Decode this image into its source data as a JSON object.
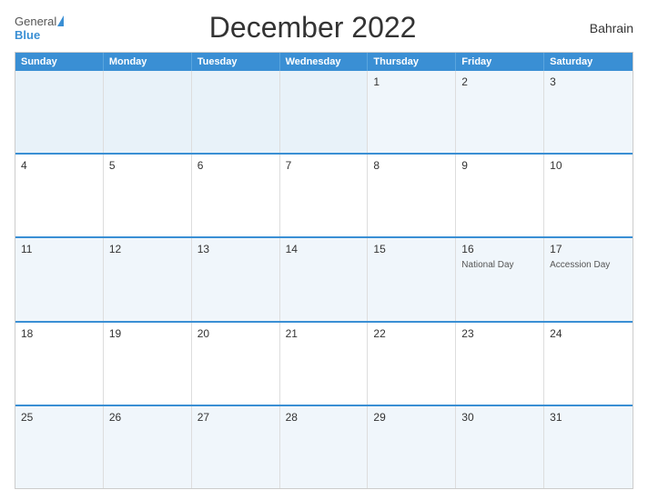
{
  "header": {
    "logo_general": "General",
    "logo_blue": "Blue",
    "title": "December 2022",
    "country": "Bahrain"
  },
  "calendar": {
    "weekdays": [
      "Sunday",
      "Monday",
      "Tuesday",
      "Wednesday",
      "Thursday",
      "Friday",
      "Saturday"
    ],
    "rows": [
      [
        {
          "day": "",
          "empty": true
        },
        {
          "day": "",
          "empty": true
        },
        {
          "day": "",
          "empty": true
        },
        {
          "day": "",
          "empty": true
        },
        {
          "day": "1",
          "empty": false
        },
        {
          "day": "2",
          "empty": false
        },
        {
          "day": "3",
          "empty": false
        }
      ],
      [
        {
          "day": "4",
          "empty": false
        },
        {
          "day": "5",
          "empty": false
        },
        {
          "day": "6",
          "empty": false
        },
        {
          "day": "7",
          "empty": false
        },
        {
          "day": "8",
          "empty": false
        },
        {
          "day": "9",
          "empty": false
        },
        {
          "day": "10",
          "empty": false
        }
      ],
      [
        {
          "day": "11",
          "empty": false
        },
        {
          "day": "12",
          "empty": false
        },
        {
          "day": "13",
          "empty": false
        },
        {
          "day": "14",
          "empty": false
        },
        {
          "day": "15",
          "empty": false
        },
        {
          "day": "16",
          "empty": false,
          "event": "National Day"
        },
        {
          "day": "17",
          "empty": false,
          "event": "Accession Day"
        }
      ],
      [
        {
          "day": "18",
          "empty": false
        },
        {
          "day": "19",
          "empty": false
        },
        {
          "day": "20",
          "empty": false
        },
        {
          "day": "21",
          "empty": false
        },
        {
          "day": "22",
          "empty": false
        },
        {
          "day": "23",
          "empty": false
        },
        {
          "day": "24",
          "empty": false
        }
      ],
      [
        {
          "day": "25",
          "empty": false
        },
        {
          "day": "26",
          "empty": false
        },
        {
          "day": "27",
          "empty": false
        },
        {
          "day": "28",
          "empty": false
        },
        {
          "day": "29",
          "empty": false
        },
        {
          "day": "30",
          "empty": false
        },
        {
          "day": "31",
          "empty": false
        }
      ]
    ]
  }
}
